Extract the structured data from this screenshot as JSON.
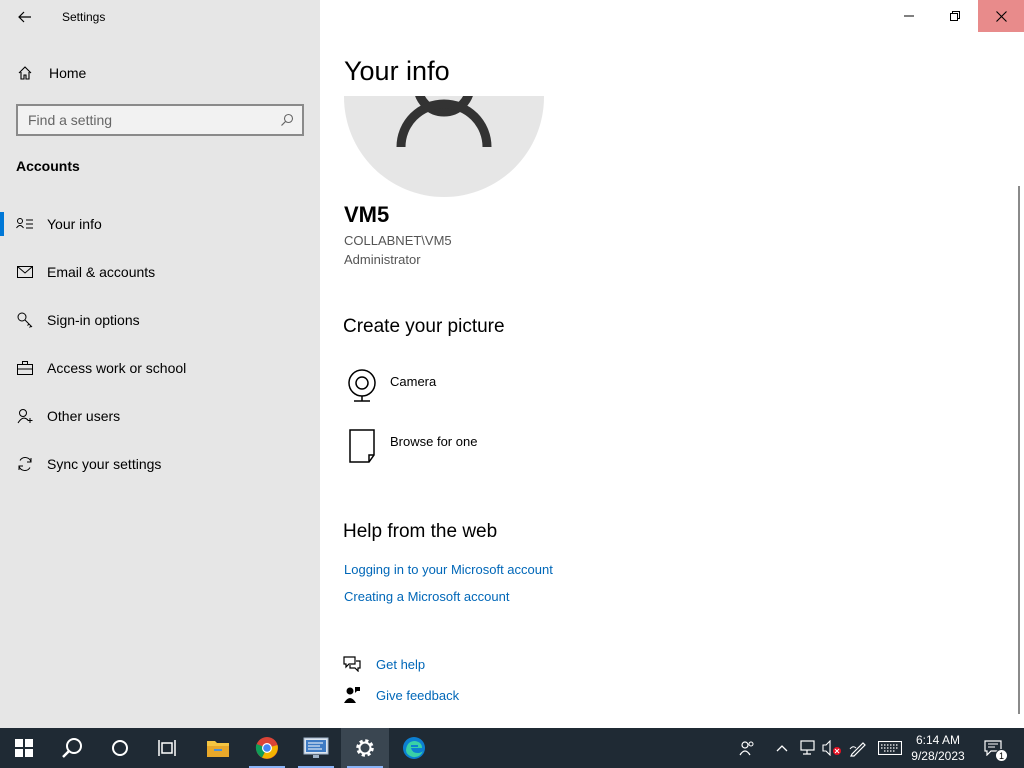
{
  "window": {
    "title": "Settings"
  },
  "sidebar": {
    "home_label": "Home",
    "search_placeholder": "Find a setting",
    "section_heading": "Accounts",
    "items": [
      {
        "label": "Your info",
        "icon": "contact-info-icon",
        "active": true
      },
      {
        "label": "Email & accounts",
        "icon": "mail-icon",
        "active": false
      },
      {
        "label": "Sign-in options",
        "icon": "key-icon",
        "active": false
      },
      {
        "label": "Access work or school",
        "icon": "briefcase-icon",
        "active": false
      },
      {
        "label": "Other users",
        "icon": "person-add-icon",
        "active": false
      },
      {
        "label": "Sync your settings",
        "icon": "sync-icon",
        "active": false
      }
    ]
  },
  "main": {
    "title": "Your info",
    "user": {
      "name": "VM5",
      "domain": "COLLABNET\\VM5",
      "role": "Administrator"
    },
    "create_picture": {
      "heading": "Create your picture",
      "options": [
        {
          "label": "Camera",
          "icon": "webcam-icon"
        },
        {
          "label": "Browse for one",
          "icon": "document-icon"
        }
      ]
    },
    "help": {
      "heading": "Help from the web",
      "links": [
        "Logging in to your Microsoft account",
        "Creating a Microsoft account"
      ]
    },
    "support": {
      "get_help": "Get help",
      "give_feedback": "Give feedback"
    }
  },
  "taskbar": {
    "apps": [
      "start",
      "search",
      "cortana",
      "task-view",
      "file-explorer",
      "chrome",
      "remote-desktop",
      "settings",
      "edge"
    ],
    "time": "6:14 AM",
    "date": "9/28/2023",
    "notification_count": "1"
  },
  "colors": {
    "accent": "#0078d7",
    "link": "#0067b8",
    "sidebar_bg": "#e6e6e6",
    "taskbar_bg": "#1f2a34",
    "close_hover": "#e88b8b"
  }
}
